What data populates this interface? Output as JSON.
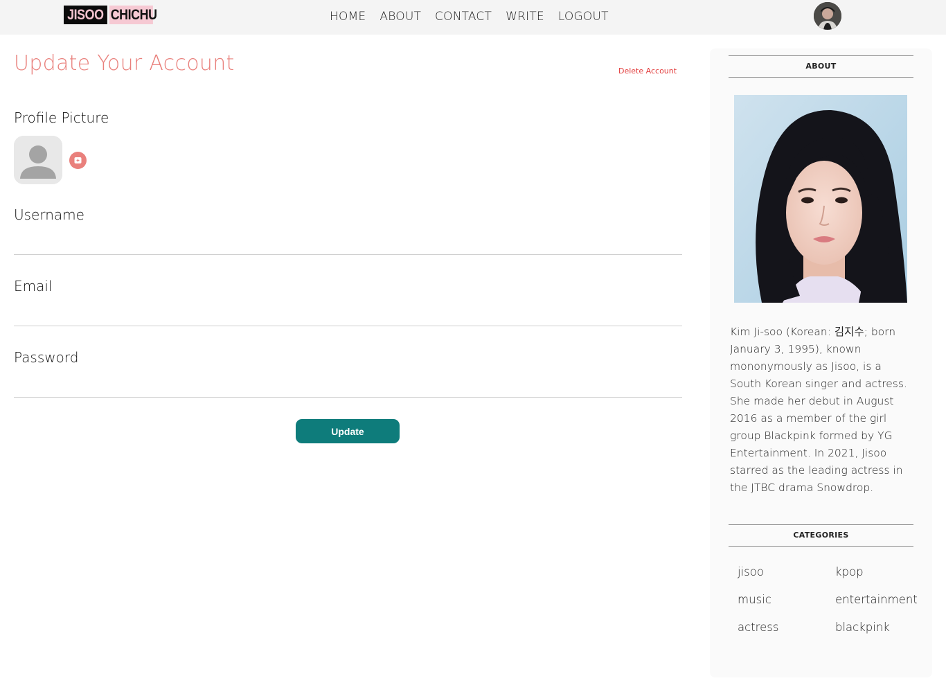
{
  "header": {
    "logo_part1": "JISOO",
    "logo_part2": "CHICHU",
    "nav": [
      "HOME",
      "ABOUT",
      "CONTACT",
      "WRITE",
      "LOGOUT"
    ]
  },
  "form": {
    "title": "Update Your Account",
    "delete_label": "Delete Account",
    "profile_picture_label": "Profile Picture",
    "username_label": "Username",
    "username_value": "",
    "email_label": "Email",
    "email_value": "",
    "password_label": "Password",
    "password_value": "",
    "update_label": "Update"
  },
  "sidebar": {
    "about_title": "ABOUT",
    "about_text": "Kim Ji-soo (Korean: 김지수; born January 3, 1995), known mononymously as Jisoo, is a South Korean singer and actress. She made her debut in August 2016 as a member of the girl group Blackpink formed by YG Entertainment. In 2021, Jisoo starred as the leading actress in the JTBC drama Snowdrop.",
    "categories_title": "CATEGORIES",
    "categories": [
      "jisoo",
      "kpop",
      "music",
      "entertainment",
      "actress",
      "blackpink"
    ]
  },
  "colors": {
    "accent": "#e9807c",
    "button": "#0e7c7b",
    "danger": "#e23b3b",
    "topbar": "#f4f4f4"
  },
  "icons": {
    "add_photo": "add-photo-icon",
    "user_placeholder": "user-placeholder-icon"
  }
}
